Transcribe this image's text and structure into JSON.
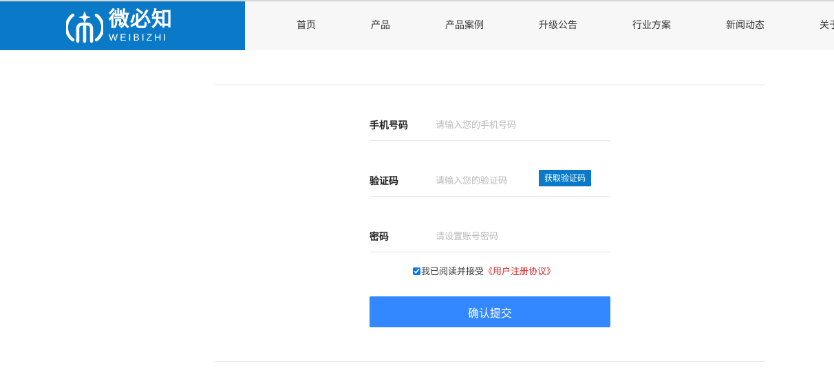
{
  "brand": {
    "name_cn": "微必知",
    "name_en": "WEIBIZHI",
    "logo_icon": "weibizhi-logo-icon",
    "color": "#0a7ac8"
  },
  "nav": {
    "items": [
      {
        "label": "首页"
      },
      {
        "label": "产品"
      },
      {
        "label": "产品案例"
      },
      {
        "label": "升级公告"
      },
      {
        "label": "行业方案"
      },
      {
        "label": "新闻动态"
      },
      {
        "label": "关于"
      }
    ]
  },
  "form": {
    "phone": {
      "label": "手机号码",
      "placeholder": "请输入您的手机号码",
      "value": ""
    },
    "code": {
      "label": "验证码",
      "placeholder": "请输入您的验证码",
      "value": "",
      "button": "获取验证码"
    },
    "password": {
      "label": "密码",
      "placeholder": "请设置账号密码",
      "value": ""
    },
    "agreement": {
      "checked": true,
      "text": "我已阅读并接受",
      "link": "《用户注册协议》",
      "link_color": "#e0262a"
    },
    "submit": "确认提交",
    "submit_color": "#3388ff"
  }
}
